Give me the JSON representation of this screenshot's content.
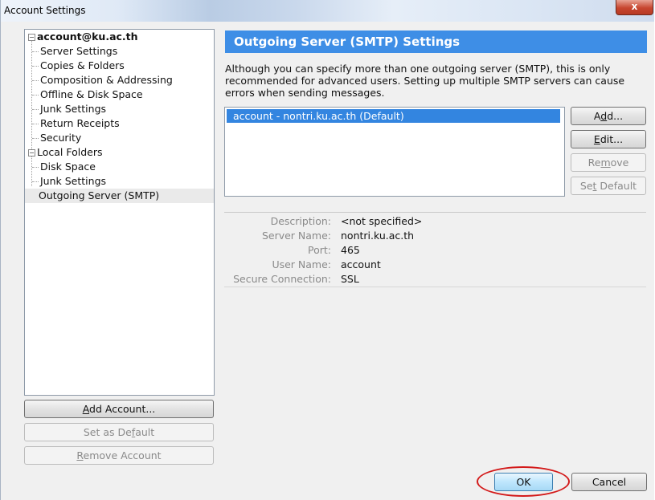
{
  "window": {
    "title": "Account Settings",
    "close_glyph": "x"
  },
  "tree": {
    "account": {
      "label": "account@ku.ac.th",
      "expander": "−",
      "children": [
        "Server Settings",
        "Copies & Folders",
        "Composition & Addressing",
        "Offline & Disk Space",
        "Junk Settings",
        "Return Receipts",
        "Security"
      ]
    },
    "local": {
      "label": "Local Folders",
      "expander": "−",
      "children": [
        "Disk Space",
        "Junk Settings"
      ]
    },
    "outgoing": "Outgoing Server (SMTP)"
  },
  "left_buttons": {
    "add_account": {
      "pre": "",
      "key": "A",
      "post": "dd Account..."
    },
    "set_default": {
      "pre": "Set as De",
      "key": "f",
      "post": "ault"
    },
    "remove_account": {
      "pre": "",
      "key": "R",
      "post": "emove Account"
    }
  },
  "panel": {
    "title": "Outgoing Server (SMTP) Settings",
    "description": "Although you can specify more than one outgoing server (SMTP), this is only recommended for advanced users. Setting up multiple SMTP servers can cause errors when sending messages."
  },
  "servers": [
    "account - nontri.ku.ac.th (Default)"
  ],
  "server_buttons": {
    "add": {
      "pre": "A",
      "key": "d",
      "post": "d..."
    },
    "edit": {
      "pre": "",
      "key": "E",
      "post": "dit..."
    },
    "remove": {
      "pre": "Re",
      "key": "m",
      "post": "ove"
    },
    "set_default": {
      "pre": "Se",
      "key": "t",
      "post": " Default"
    }
  },
  "details": {
    "description_label": "Description:",
    "description_value": "<not specified>",
    "server_name_label": "Server Name:",
    "server_name_value": "nontri.ku.ac.th",
    "port_label": "Port:",
    "port_value": "465",
    "user_name_label": "User Name:",
    "user_name_value": "account",
    "secure_label": "Secure Connection:",
    "secure_value": "SSL"
  },
  "dialog_buttons": {
    "ok": "OK",
    "cancel": "Cancel"
  },
  "colors": {
    "header_blue": "#3e8ee6",
    "selection_blue": "#3385e0",
    "annotation_red": "#d31a1a"
  }
}
